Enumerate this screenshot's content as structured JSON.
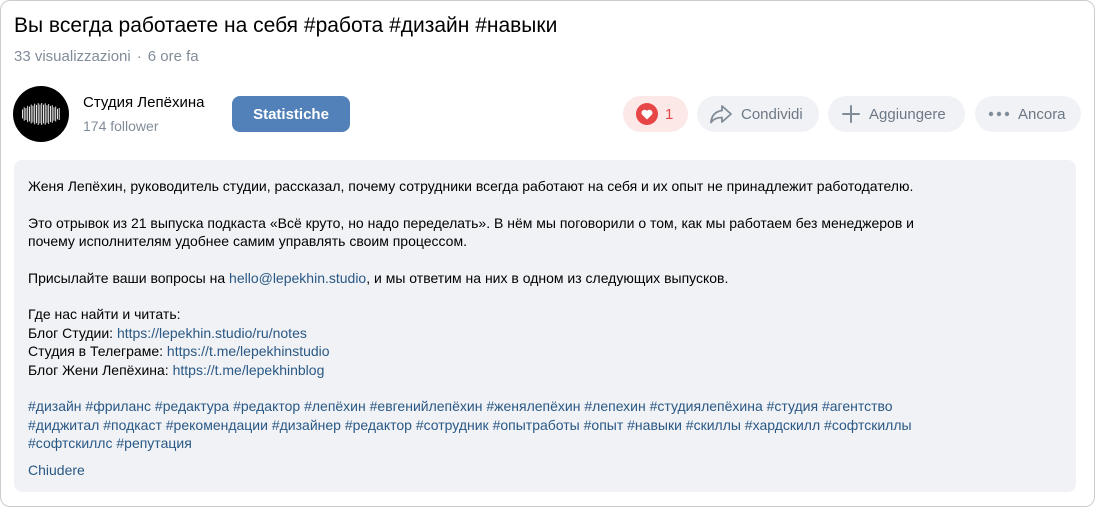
{
  "video": {
    "title": "Вы всегда работаете на себя #работа #дизайн #навыки",
    "views": "33 visualizzazioni",
    "time_ago": "6 ore fa"
  },
  "channel": {
    "name": "Студия Лепёхина",
    "followers": "174 follower"
  },
  "actions": {
    "stats_label": "Statistiche",
    "like_count": "1",
    "share_label": "Condividi",
    "add_label": "Aggiungere",
    "more_label": "Ancora"
  },
  "description": {
    "line1": "Женя Лепёхин, руководитель студии, рассказал, почему сотрудники всегда работают на себя и их опыт не принадлежит работодателю.",
    "line2a": "Это отрывок из 21 выпуска подкаста «Всё круто, но надо переделать». В нём мы поговорили о том, как мы работаем без менеджеров и",
    "line2b": "почему исполнителям удобнее самим управлять своим процессом.",
    "questions_prefix": "Присылайте ваши вопросы на ",
    "email": "hello@lepekhin.studio",
    "questions_suffix": ", и мы ответим на них в одном из следующих выпусков.",
    "find_us": "Где нас найти и читать:",
    "blog_label": "Блог Студии: ",
    "blog_url": "https://lepekhin.studio/ru/notes",
    "telegram_label": "Студия в Телеграме: ",
    "telegram_url": "https://t.me/lepekhinstudio",
    "zhenya_label": "Блог Жени Лепёхина: ",
    "zhenya_url": "https://t.me/lepekhinblog",
    "tags_line1": "#дизайн #фриланс #редактура #редактор #лепёхин #евгенийлепёхин #женялепёхин #лепехин #студиялепёхина #студия #агентство",
    "tags_line2": "#диджитал #подкаст #рекомендации #дизайнер #редактор #сотрудник #опытработы #опыт #навыки #скиллы #хардскилл #софтскиллы",
    "tags_line3": "#софтскиллс #репутация",
    "collapse_label": "Chiudere"
  },
  "colors": {
    "accent": "#5181b8",
    "link": "#2a5885",
    "like": "#e64646",
    "secondary_text": "#818c99",
    "pill_bg": "#f0f2f5"
  },
  "icons": {
    "like": "heart-icon",
    "share": "share-arrow-icon",
    "add": "plus-icon",
    "more": "more-dots-icon"
  }
}
